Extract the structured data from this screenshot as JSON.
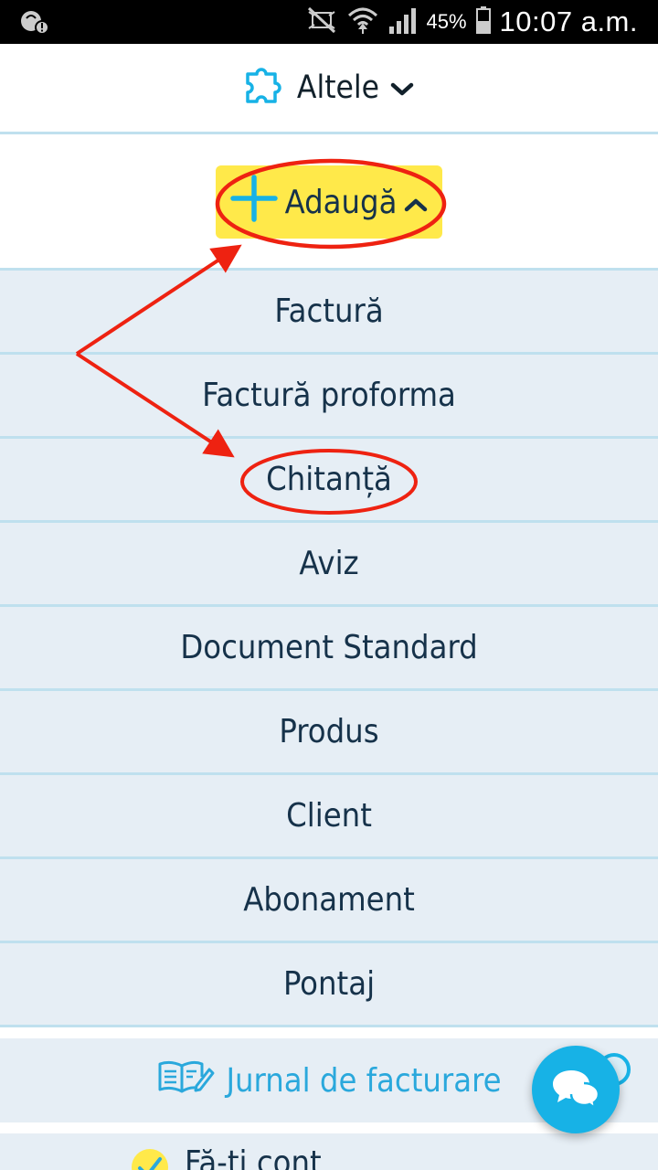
{
  "status_bar": {
    "battery_percent": "45%",
    "time": "10:07 a.m."
  },
  "header": {
    "title": "Altele"
  },
  "add_button": {
    "label": "Adaugă"
  },
  "menu": {
    "items": [
      {
        "label": "Factură"
      },
      {
        "label": "Factură proforma"
      },
      {
        "label": "Chitanță"
      },
      {
        "label": "Aviz"
      },
      {
        "label": "Document Standard"
      },
      {
        "label": "Produs"
      },
      {
        "label": "Client"
      },
      {
        "label": "Abonament"
      },
      {
        "label": "Pontaj"
      }
    ]
  },
  "journal": {
    "label": "Jurnal de facturare"
  },
  "account": {
    "label": "Fă-ți cont"
  },
  "colors": {
    "accent_blue": "#17b2e6",
    "highlight_yellow": "#ffe94a",
    "annotation_red": "#ee2211",
    "menu_bg": "#e6eef5"
  },
  "icons": [
    "puzzle-icon",
    "chevron-down-icon",
    "plus-icon",
    "chevron-up-icon",
    "book-edit-icon",
    "chat-icon",
    "check-icon"
  ]
}
